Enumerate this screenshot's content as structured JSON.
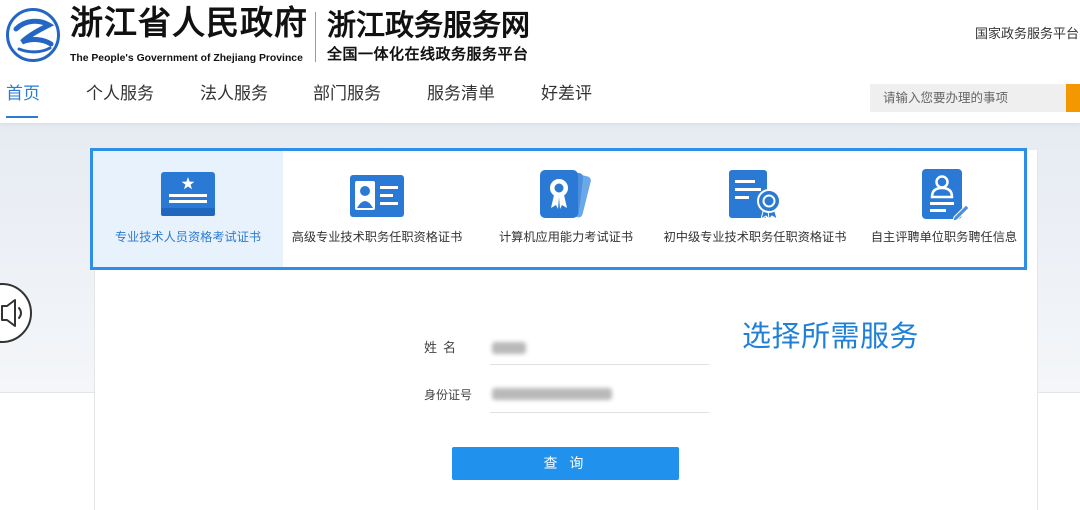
{
  "header": {
    "logo_icon": "zhejiang-swirl-logo-icon",
    "gov_title": "浙江省人民政府",
    "gov_subtitle_en": "The People's Government of Zhejiang Province",
    "site_title": "浙江政务服务网",
    "site_subtitle": "全国一体化在线政务服务平台",
    "national_platform_link": "国家政务服务平台"
  },
  "nav": {
    "items": [
      {
        "label": "首页",
        "active": true
      },
      {
        "label": "个人服务",
        "active": false
      },
      {
        "label": "法人服务",
        "active": false
      },
      {
        "label": "部门服务",
        "active": false
      },
      {
        "label": "服务清单",
        "active": false
      },
      {
        "label": "好差评",
        "active": false
      }
    ]
  },
  "search": {
    "placeholder": "请输入您要办理的事项",
    "value": ""
  },
  "tabs": [
    {
      "label": "专业技术人员资格考试证书",
      "icon": "certificate-star-icon",
      "active": true
    },
    {
      "label": "高级专业技术职务任职资格证书",
      "icon": "id-card-icon",
      "active": false
    },
    {
      "label": "计算机应用能力考试证书",
      "icon": "award-badge-icon",
      "active": false
    },
    {
      "label": "初中级专业技术职务任职资格证书",
      "icon": "document-seal-icon",
      "active": false
    },
    {
      "label": "自主评聘单位职务聘任信息",
      "icon": "person-document-icon",
      "active": false
    }
  ],
  "side": {
    "audio_icon": "speaker-icon"
  },
  "form": {
    "name_label": "姓名",
    "id_label": "身份证号",
    "name_value_redacted": true,
    "id_value_redacted": true,
    "hint": "选择所需服务",
    "query_button": "查 询"
  },
  "colors": {
    "primary": "#2e8fe8",
    "nav_active": "#2b7bd3",
    "search_button": "#f39800",
    "active_tab_bg": "#e8f2fc",
    "query_button": "#2091ec"
  }
}
